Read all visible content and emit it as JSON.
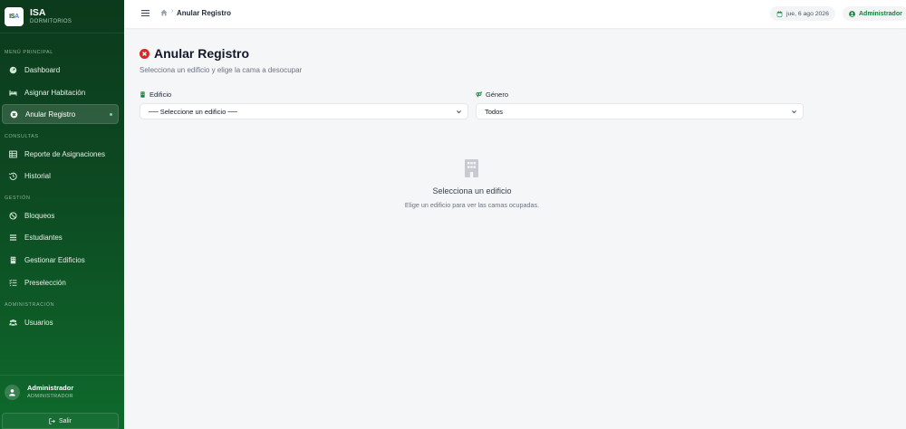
{
  "brand": {
    "logo": "ISA",
    "title": "ISA",
    "subtitle": "DORMITORIOS"
  },
  "sidebar": {
    "sections": [
      {
        "label": "MENÚ PRINCIPAL"
      },
      {
        "label": "CONSULTAS"
      },
      {
        "label": "GESTIÓN"
      },
      {
        "label": "ADMINISTRACIÓN"
      }
    ],
    "items": [
      {
        "label": "Dashboard",
        "icon": "gauge-icon"
      },
      {
        "label": "Asignar Habitación",
        "icon": "bed-icon"
      },
      {
        "label": "Anular Registro",
        "icon": "cancel-circle-icon",
        "active": true
      },
      {
        "label": "Reporte de Asignaciones",
        "icon": "table-icon"
      },
      {
        "label": "Historial",
        "icon": "history-icon"
      },
      {
        "label": "Bloqueos",
        "icon": "ban-icon"
      },
      {
        "label": "Estudiantes",
        "icon": "graduation-icon"
      },
      {
        "label": "Gestionar Edificios",
        "icon": "building-icon"
      },
      {
        "label": "Preselección",
        "icon": "list-check-icon"
      },
      {
        "label": "Usuarios",
        "icon": "users-icon"
      }
    ],
    "user": {
      "name": "Administrador",
      "role": "ADMINISTRADOR"
    },
    "logout_label": "Salir"
  },
  "topbar": {
    "breadcrumb_current": "Anular Registro",
    "date": "jue, 6 ago 2026",
    "user_label": "Administrador"
  },
  "main": {
    "title": "Anular Registro",
    "subtitle": "Selecciona un edificio y elige la cama a desocupar",
    "building_label": "Edificio",
    "building_value": "── Seleccione un edificio ──",
    "gender_label": "Género",
    "gender_value": "Todos",
    "empty_title": "Selecciona un edificio",
    "empty_sub": "Elige un edificio para ver las camas ocupadas."
  },
  "colors": {
    "sidebar_dark": "#0c3a1c",
    "sidebar_light": "#0e6a2c",
    "accent_green": "#15803d",
    "danger_red": "#dc2626"
  }
}
